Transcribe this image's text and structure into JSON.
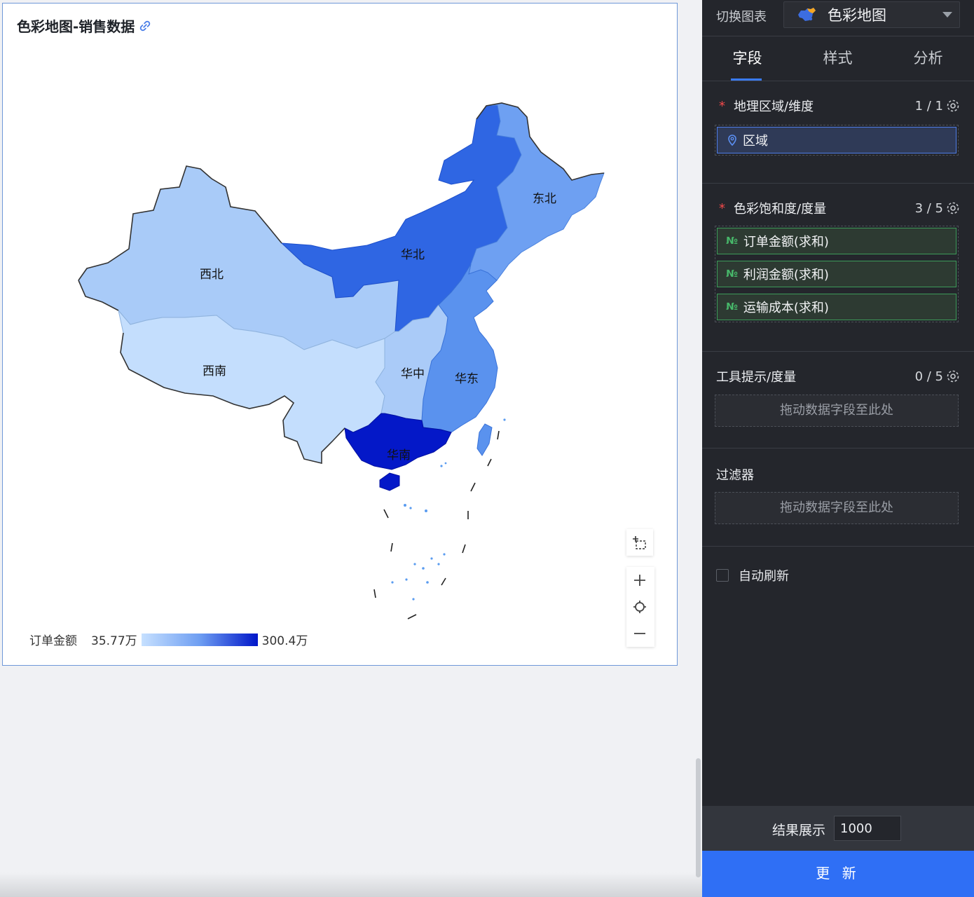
{
  "chart": {
    "title": "色彩地图-销售数据",
    "regions": [
      {
        "name": "西北",
        "color": "#a9cbf8"
      },
      {
        "name": "华北",
        "color": "#2f66e3"
      },
      {
        "name": "东北",
        "color": "#6ea0f2"
      },
      {
        "name": "西南",
        "color": "#c4defd"
      },
      {
        "name": "华中",
        "color": "#aacbf8"
      },
      {
        "name": "华东",
        "color": "#5a92ee"
      },
      {
        "name": "华南",
        "color": "#0418c8"
      }
    ],
    "legend": {
      "name": "订单金额",
      "min": "35.77万",
      "max": "300.4万",
      "color_min": "#c6e0ff",
      "color_max": "#0016c9"
    },
    "tools": [
      "select-box",
      "zoom-in",
      "locate",
      "zoom-out"
    ]
  },
  "panel": {
    "switch_label": "切换图表",
    "chart_type": "色彩地图",
    "tabs": [
      "字段",
      "样式",
      "分析"
    ],
    "active_tab": 0,
    "geo": {
      "title": "地理区域/维度",
      "count": "1 / 1",
      "fields": [
        "区域"
      ]
    },
    "color": {
      "title": "色彩饱和度/度量",
      "count": "3 / 5",
      "fields": [
        "订单金额(求和)",
        "利润金额(求和)",
        "运输成本(求和)"
      ],
      "num_icon": "№"
    },
    "tooltip": {
      "title": "工具提示/度量",
      "count": "0 / 5",
      "placeholder": "拖动数据字段至此处"
    },
    "filter": {
      "title": "过滤器",
      "placeholder": "拖动数据字段至此处"
    },
    "required_mark": "*",
    "auto_refresh": "自动刷新",
    "result_label": "结果展示",
    "result_value": "1000",
    "update_button": "更 新"
  }
}
